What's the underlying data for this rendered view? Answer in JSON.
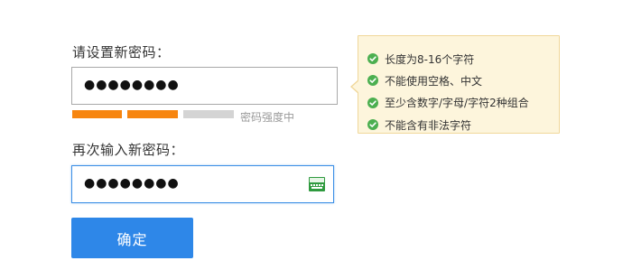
{
  "form": {
    "password_label": "请设置新密码：",
    "password_value": "●●●●●●●●",
    "strength_label": "密码强度中",
    "strength_colors": [
      "#f7850f",
      "#f7850f",
      "#d4d4d4"
    ],
    "confirm_label": "再次输入新密码：",
    "confirm_value": "●●●●●●●●",
    "keyboard_icon": "virtual-keyboard-icon",
    "submit_label": "确定"
  },
  "tips": {
    "icon": "check-circle-icon",
    "check_color": "#4caf50",
    "items": [
      "长度为8-16个字符",
      "不能使用空格、中文",
      "至少含数字/字母/字符2种组合",
      "不能含有非法字符"
    ]
  }
}
